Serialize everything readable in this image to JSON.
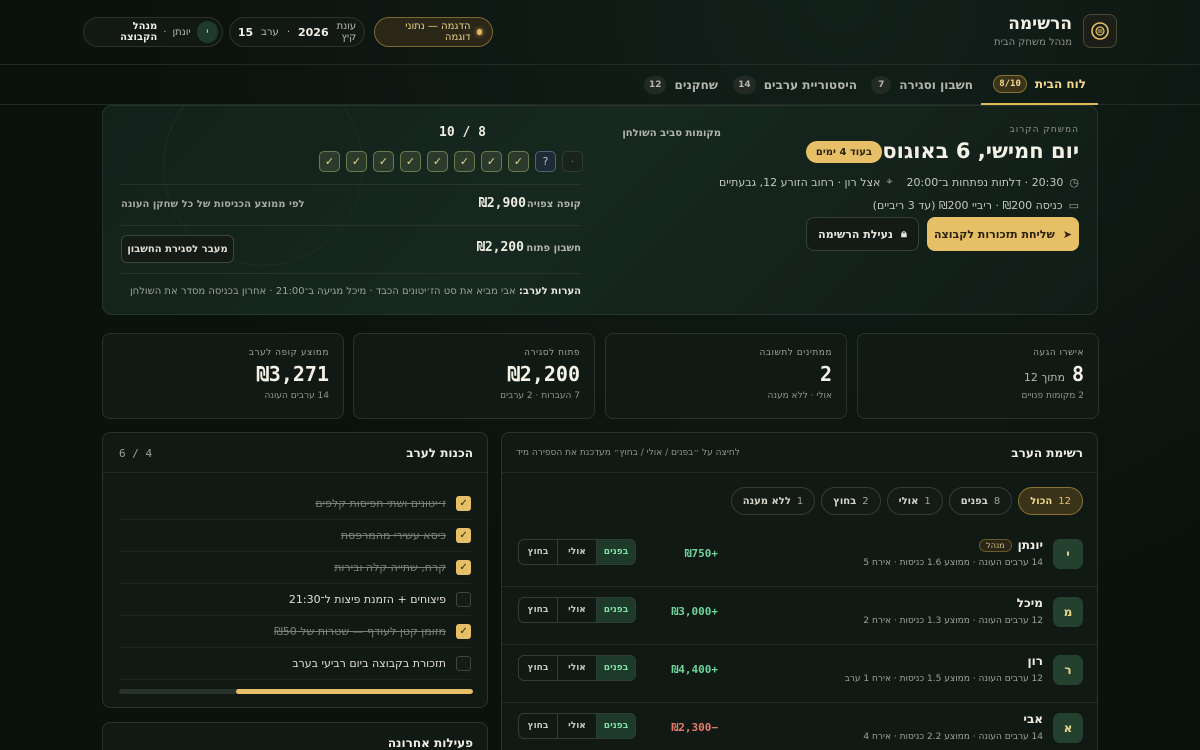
{
  "header": {
    "title": "הרשימה",
    "subtitle": "מנהל משחק הבית",
    "demo_badge": "הדגמה — נתוני דוגמה",
    "season_label": "עונת קיץ",
    "season_year": "2026",
    "night_label": "ערב",
    "night_number": "15",
    "user_initial": "י",
    "user_name": "יונתן",
    "user_role": "מנהל הקבוצה"
  },
  "tabs": [
    {
      "label": "לוח הבית",
      "count": "8/10",
      "active": true
    },
    {
      "label": "חשבון וסגירה",
      "count": "7"
    },
    {
      "label": "היסטוריית ערבים",
      "count": "14"
    },
    {
      "label": "שחקנים",
      "count": "12"
    }
  ],
  "next_game": {
    "label": "המשחק הקרוב",
    "title": "יום חמישי, 6 באוגוסט",
    "countdown": "בעוד 4 ימים",
    "time_line": "20:30 · דלתות נפתחות ב־20:00",
    "location_line": "אצל רון · רחוב הזורע 12, גבעתיים",
    "buyin_line": "כניסה ₪200 · ריביי ₪200 (עד 3 ריביים)",
    "send_reminder": "שליחת תזכורות לקבוצה",
    "lock_list": "נעילת הרשימה"
  },
  "seats": {
    "label": "מקומות סביב השולחן",
    "count": "8 / 10",
    "marks": [
      "✓",
      "✓",
      "✓",
      "✓",
      "✓",
      "✓",
      "✓",
      "✓",
      "?",
      "·"
    ]
  },
  "finance": {
    "pot_label": "קופה צפויה",
    "pot_value": "₪2,900",
    "pot_note": "לפי ממוצע הכניסות של כל שחקן העונה",
    "open_label": "חשבון פתוח",
    "open_value": "₪2,200",
    "open_button": "מעבר לסגירת החשבון",
    "notes_label": "הערות לערב:",
    "notes_text": "אבי מביא את סט הז׳יטונים הכבד · מיכל מגיעה ב־21:00 · אחרון בכניסה מסדר את השולחן"
  },
  "stats": [
    {
      "label": "אישרו הגעה",
      "value": "8",
      "of": "מתוך 12",
      "sub": "2 מקומות פנויים"
    },
    {
      "label": "ממתינים לתשובה",
      "value": "2",
      "of": "",
      "sub": "אולי · ללא מענה"
    },
    {
      "label": "פתוח לסגירה",
      "value": "₪2,200",
      "of": "",
      "sub": "7 העברות · 2 ערבים"
    },
    {
      "label": "ממוצע קופה לערב",
      "value": "₪3,271",
      "of": "",
      "sub": "14 ערבים העונה"
    }
  ],
  "roster": {
    "title": "רשימת הערב",
    "hint": "לחיצה על ״בפנים / אולי / בחוץ״ מעדכנת את הספירה מיד",
    "filters": [
      {
        "label": "הכול",
        "count": "12",
        "active": true
      },
      {
        "label": "בפנים",
        "count": "8"
      },
      {
        "label": "אולי",
        "count": "1"
      },
      {
        "label": "בחוץ",
        "count": "2"
      },
      {
        "label": "ללא מענה",
        "count": "1"
      }
    ],
    "seg_labels": {
      "in": "בפנים",
      "maybe": "אולי",
      "out": "בחוץ"
    },
    "players": [
      {
        "initial": "י",
        "name": "יונתן",
        "badge": "מנהל",
        "stats": "14 ערבים העונה · ממוצע 1.6 כניסות · אירח 5",
        "net": "+₪750",
        "dir": "pos"
      },
      {
        "initial": "מ",
        "name": "מיכל",
        "badge": "",
        "stats": "12 ערבים העונה · ממוצע 1.3 כניסות · אירח 2",
        "net": "+₪3,000",
        "dir": "pos"
      },
      {
        "initial": "ר",
        "name": "רון",
        "badge": "",
        "stats": "12 ערבים העונה · ממוצע 1.5 כניסות · אירח 1 ערב",
        "net": "+₪4,400",
        "dir": "pos"
      },
      {
        "initial": "א",
        "name": "אבי",
        "badge": "",
        "stats": "14 ערבים העונה · ממוצע 2.2 כניסות · אירח 4",
        "net": "−₪2,300",
        "dir": "neg"
      }
    ]
  },
  "prep": {
    "title": "הכנות לערב",
    "count": "4 / 6",
    "progress": 0.67,
    "tasks": [
      {
        "text": "ז׳יטונים ושתי חפיסות קלפים",
        "done": true
      },
      {
        "text": "כיסא עשירי מהמרפסת",
        "done": true
      },
      {
        "text": "קרח, שתייה קלה ובירות",
        "done": true
      },
      {
        "text": "פיצוחים + הזמנת פיצות ל־21:30",
        "done": false
      },
      {
        "text": "מזומן קטן לעודף — שטרות של ₪50",
        "done": true
      },
      {
        "text": "תזכורת בקבוצה ביום רביעי בערב",
        "done": false
      }
    ]
  },
  "activity": {
    "title": "פעילות אחרונה"
  },
  "colors": {
    "accent": "#e6bf66",
    "positive": "#6fd39a",
    "negative": "#e47e6a",
    "background": "#0b110d"
  }
}
